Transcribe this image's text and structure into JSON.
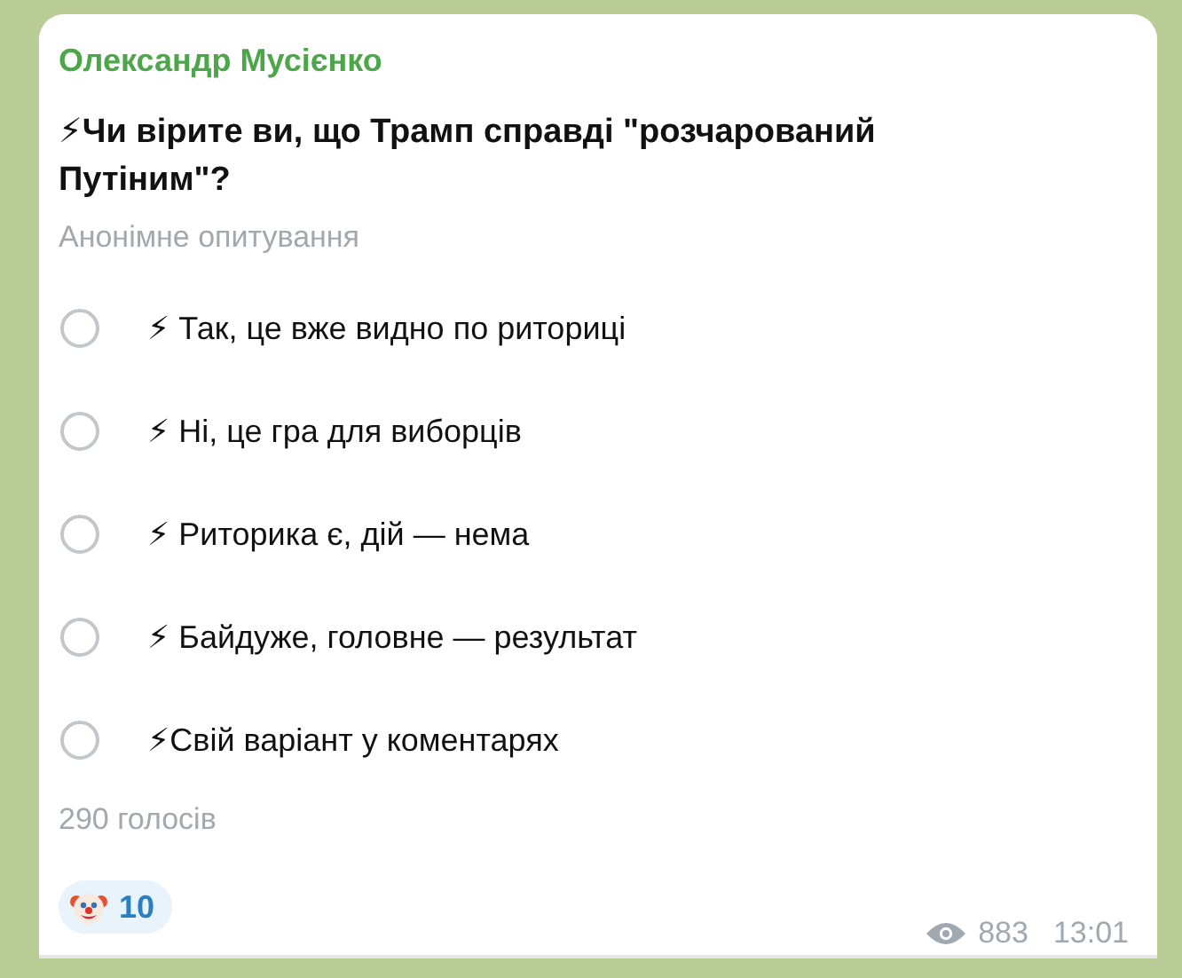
{
  "message": {
    "author": "Олександр Мусієнко",
    "question": "⚡Чи вірите ви, що Трамп справді \"розчарований Путіним\"?",
    "poll_type": "Анонімне опитування",
    "options": [
      {
        "label": "⚡ Так, це вже видно по риториці",
        "selected": false
      },
      {
        "label": "⚡ Ні, це гра для виборців",
        "selected": false
      },
      {
        "label": "⚡ Риторика є, дій — нема",
        "selected": false
      },
      {
        "label": "⚡ Байдуже, головне — результат",
        "selected": false
      },
      {
        "label": "⚡Свій варіант у коментарях",
        "selected": false
      }
    ],
    "votes": "290 голосів",
    "reaction": {
      "count": "10"
    },
    "views": "883",
    "time": "13:01"
  }
}
